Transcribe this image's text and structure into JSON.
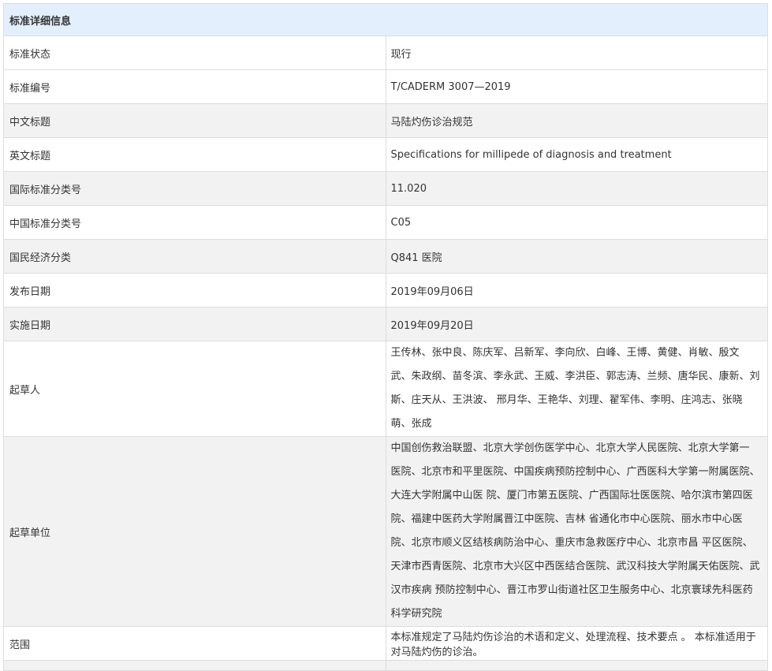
{
  "header": {
    "title": "标准详细信息"
  },
  "rows": [
    {
      "label": "标准状态",
      "value": "现行"
    },
    {
      "label": "标准编号",
      "value": "T/CADERM 3007—2019"
    },
    {
      "label": "中文标题",
      "value": "马陆灼伤诊治规范"
    },
    {
      "label": "英文标题",
      "value": "Specifications for millipede of diagnosis and treatment"
    },
    {
      "label": "国际标准分类号",
      "value": "11.020"
    },
    {
      "label": "中国标准分类号",
      "value": "C05"
    },
    {
      "label": "国民经济分类",
      "value": "Q841 医院"
    },
    {
      "label": "发布日期",
      "value": "2019年09月06日"
    },
    {
      "label": "实施日期",
      "value": "2019年09月20日"
    },
    {
      "label": "起草人",
      "value": "王传林、张中良、陈庆军、吕新军、李向欣、白峰、王博、黄健、肖敏、殷文 武、朱政纲、苗冬滨、李永武、王威、李洪臣、郭志涛、兰频、唐华民、康新、刘斯、庄天从、王洪波、 邢月华、王艳华、刘理、翟军伟、李明、庄鸿志、张晓萌、张成"
    },
    {
      "label": "起草单位",
      "value": "中国创伤救治联盟、北京大学创伤医学中心、北京大学人民医院、北京大学第一 医院、北京市和平里医院、中国疾病预防控制中心、广西医科大学第一附属医院、大连大学附属中山医 院、厦门市第五医院、广西国际壮医医院、哈尔滨市第四医院、福建中医药大学附属晋江中医院、吉林 省通化市中心医院、丽水市中心医院、北京市顺义区结核病防治中心、重庆市急救医疗中心、北京市昌 平区医院、天津市西青医院、北京市大兴区中西医结合医院、武汉科技大学附属天佑医院、武汉市疾病 预防控制中心、晋江市罗山街道社区卫生服务中心、北京寰球先科医药科学研究院"
    },
    {
      "label": "范围",
      "value": "本标准规定了马陆灼伤诊治的术语和定义、处理流程、技术要点 。 本标准适用于对马陆灼伤的诊治。"
    }
  ]
}
